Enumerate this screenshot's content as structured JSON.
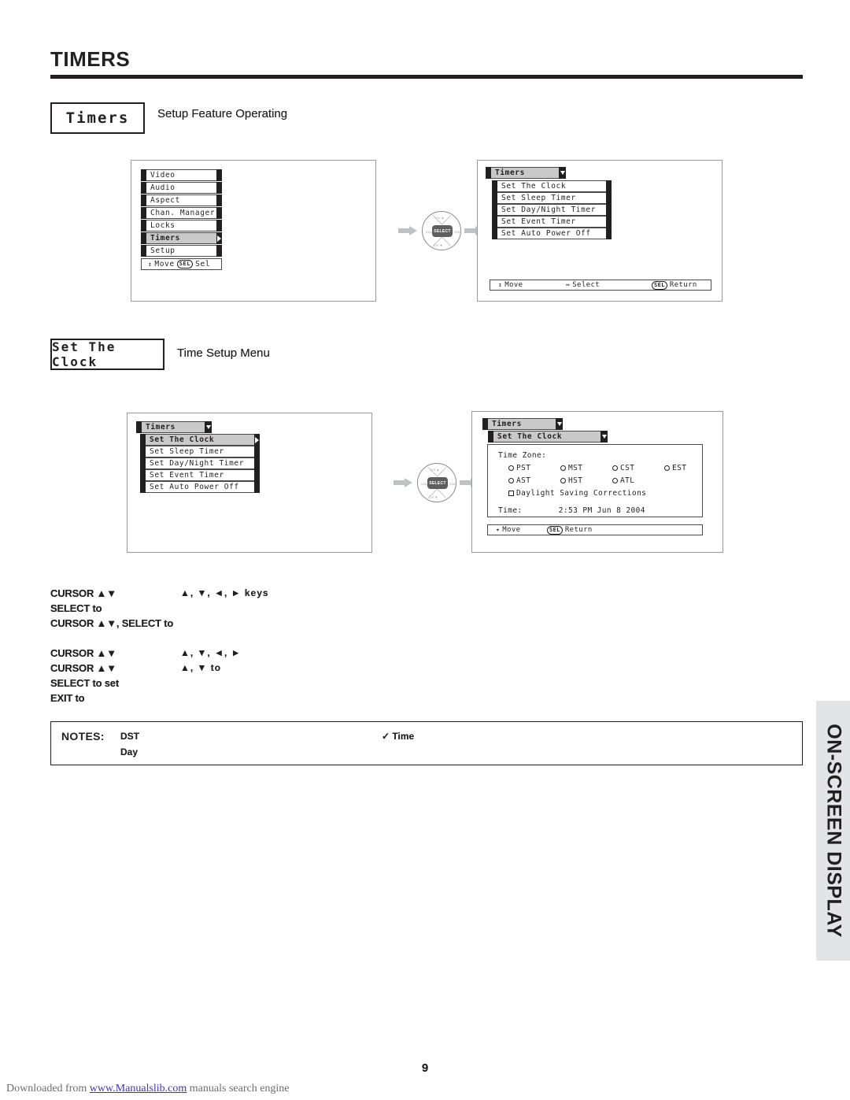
{
  "page": {
    "title": "TIMERS",
    "number": "9"
  },
  "sections": [
    {
      "chip": "Timers",
      "note": "Setup Feature Operating"
    },
    {
      "chip": "Set The Clock",
      "note": "Time Setup Menu"
    }
  ],
  "osd1": {
    "items": [
      {
        "label": "Video",
        "selected": false
      },
      {
        "label": "Audio",
        "selected": false
      },
      {
        "label": "Aspect",
        "selected": false
      },
      {
        "label": "Chan. Manager",
        "selected": false
      },
      {
        "label": "Locks",
        "selected": false
      },
      {
        "label": "Timers",
        "selected": true
      },
      {
        "label": "Setup",
        "selected": false
      }
    ],
    "movebox": {
      "move": "Move",
      "sel_key": "SEL",
      "sel_label": "Sel"
    }
  },
  "osd2": {
    "header": "Timers",
    "items": [
      {
        "label": "Set The Clock",
        "selected": false
      },
      {
        "label": "Set Sleep Timer",
        "selected": false
      },
      {
        "label": "Set Day/Night Timer",
        "selected": false
      },
      {
        "label": "Set Event Timer",
        "selected": false
      },
      {
        "label": "Set Auto Power Off",
        "selected": false
      }
    ],
    "help": {
      "move": "Move",
      "select": "Select",
      "sel_key": "SEL",
      "return": "Return"
    }
  },
  "osd3": {
    "header": "Timers",
    "items": [
      {
        "label": "Set The Clock",
        "selected": true
      },
      {
        "label": "Set Sleep Timer",
        "selected": false
      },
      {
        "label": "Set Day/Night Timer",
        "selected": false
      },
      {
        "label": "Set Event Timer",
        "selected": false
      },
      {
        "label": "Set Auto Power Off",
        "selected": false
      }
    ]
  },
  "osd4": {
    "header": "Timers",
    "subheader": "Set The Clock",
    "tz_label": "Time Zone:",
    "tz_row1": [
      "PST",
      "MST",
      "CST",
      "EST"
    ],
    "tz_row2": [
      "AST",
      "HST",
      "ATL"
    ],
    "dst_label": "Daylight Saving Corrections",
    "time_label": "Time:",
    "time_value": "2:53 PM Jun 8 2004",
    "help": {
      "move": "Move",
      "sel_key": "SEL",
      "return": "Return"
    }
  },
  "dpad": {
    "center": "SELECT",
    "up": "CH ▲",
    "down": "CH ▼",
    "left": "VOL",
    "right": "VOL"
  },
  "instructions": {
    "block1": [
      {
        "left": "CURSOR ▲▼",
        "right": "▲, ▼, ◄, ► keys"
      },
      {
        "left": "SELECT to",
        "right": ""
      },
      {
        "left": "CURSOR ▲▼, SELECT to",
        "right": ""
      }
    ],
    "block2": [
      {
        "left": "CURSOR ▲▼",
        "right": "▲, ▼, ◄, ►"
      },
      {
        "left": "CURSOR ▲▼",
        "right": "▲, ▼ to"
      },
      {
        "left": "SELECT to set",
        "right": ""
      },
      {
        "left": "EXIT to",
        "right": ""
      }
    ]
  },
  "notes": {
    "label": "NOTES:",
    "line1": "DST",
    "line2": "Day",
    "right1": "✓ Time"
  },
  "side_tab": {
    "text": "ON-SCREEN DISPLAY"
  },
  "footer": {
    "prefix": "Downloaded from ",
    "link": "www.Manualslib.com",
    "suffix": " manuals search engine"
  }
}
